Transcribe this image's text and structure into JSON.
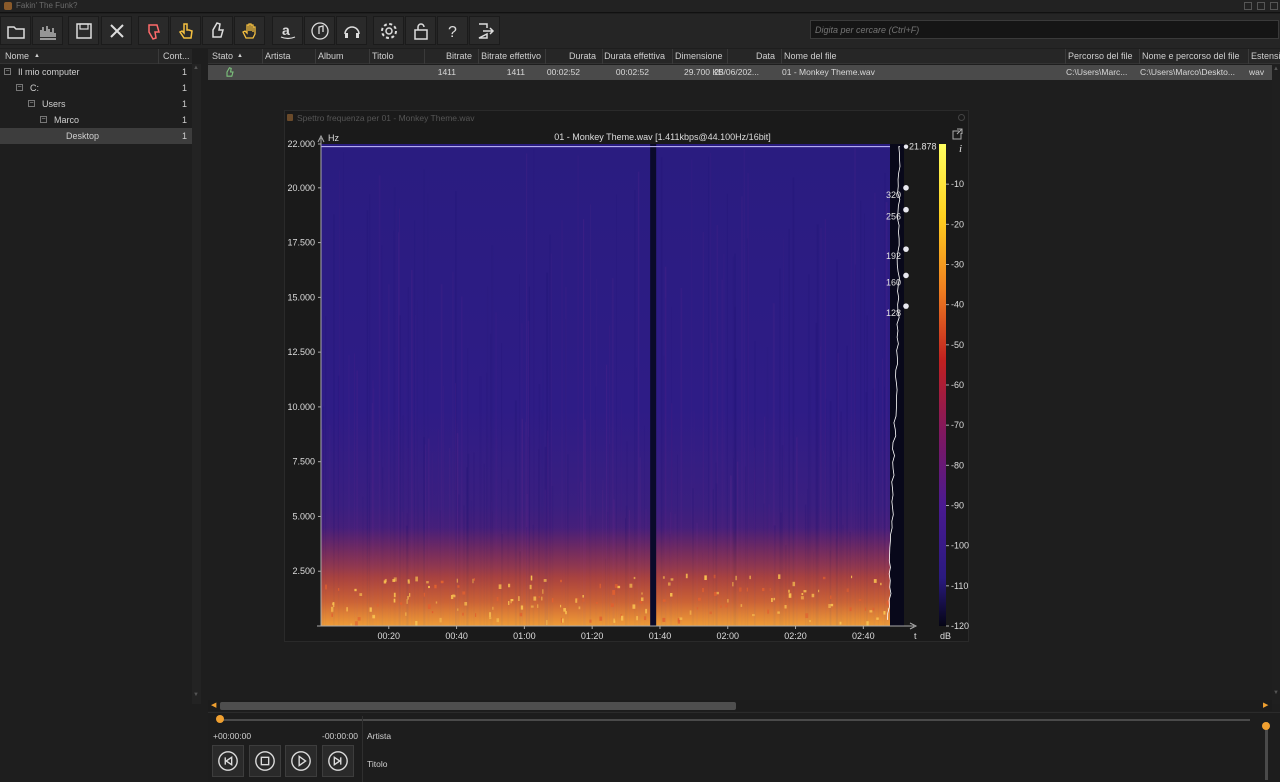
{
  "app": {
    "title": "Fakin' The Funk?"
  },
  "search": {
    "placeholder": "Digita per cercare (Ctrl+F)"
  },
  "toolbar": {
    "buttons": [
      {
        "icon": "folder-open-icon"
      },
      {
        "icon": "spectrum-analysis-icon"
      },
      {
        "icon": "save-icon"
      },
      {
        "icon": "close-x-icon"
      },
      {
        "icon": "thumbs-down-icon"
      },
      {
        "icon": "hand-point-icon"
      },
      {
        "icon": "thumbs-up-icon"
      },
      {
        "icon": "hand-stop-icon"
      },
      {
        "icon": "amazon-icon"
      },
      {
        "icon": "music-note-icon"
      },
      {
        "icon": "headphones-icon"
      },
      {
        "icon": "gear-icon"
      },
      {
        "icon": "unlock-icon"
      },
      {
        "icon": "help-icon"
      },
      {
        "icon": "exit-icon"
      }
    ]
  },
  "tree": {
    "header": {
      "name": "Nome",
      "count": "Cont..."
    },
    "items": [
      {
        "label": "Il mio computer",
        "count": "1",
        "depth": 0,
        "expand": "−"
      },
      {
        "label": "C:",
        "count": "1",
        "depth": 1,
        "expand": "−"
      },
      {
        "label": "Users",
        "count": "1",
        "depth": 2,
        "expand": "−"
      },
      {
        "label": "Marco",
        "count": "1",
        "depth": 3,
        "expand": "−"
      },
      {
        "label": "Desktop",
        "count": "1",
        "depth": 4,
        "expand": "",
        "selected": true
      }
    ]
  },
  "list": {
    "columns": [
      "Stato",
      "Artista",
      "Album",
      "Titolo",
      "Bitrate",
      "Bitrate effettivo",
      "Durata",
      "Durata effettiva",
      "Dimensione",
      "Data",
      "Nome del file",
      "Percorso del file",
      "Nome e percorso del file",
      "Estensione"
    ],
    "rows": [
      {
        "status_icon": "thumbs-up-icon",
        "artista": "",
        "album": "",
        "titolo": "",
        "bitrate": "1411",
        "bitrate_effettivo": "1411",
        "durata": "00:02:52",
        "durata_effettiva": "00:02:52",
        "dimensione": "29.700 KB",
        "data": "25/06/202...",
        "nome_file": "01 - Monkey Theme.wav",
        "percorso": "C:\\Users\\Marc...",
        "nome_percorso": "C:\\Users\\Marco\\Deskto...",
        "estensione": "wav"
      }
    ]
  },
  "player": {
    "time_elapsed": "+00:00:00",
    "time_remaining": "-00:00:00",
    "artist_label": "Artista",
    "title_label": "Titolo",
    "progress": 0.0,
    "volume": 1.0
  },
  "spectrum": {
    "window_title": "Spettro frequenza per 01 - Monkey Theme.wav",
    "plot_title": "01 - Monkey Theme.wav [1.411kbps@44.100Hz/16bit]",
    "y_unit": "Hz",
    "x_unit": "t",
    "cutoff_label": "21.878",
    "info_label": "i",
    "colorbar_unit": "dB",
    "bitrate_markers": [
      {
        "label": "320",
        "hz": 20000
      },
      {
        "label": "256",
        "hz": 19000
      },
      {
        "label": "192",
        "hz": 17200
      },
      {
        "label": "160",
        "hz": 16000
      },
      {
        "label": "128",
        "hz": 14600
      }
    ]
  },
  "chart_data": {
    "type": "heatmap",
    "title": "01 - Monkey Theme.wav [1.411kbps@44.100Hz/16bit]",
    "xlabel": "t",
    "ylabel": "Hz",
    "x_ticks": [
      "00:20",
      "00:40",
      "01:00",
      "01:20",
      "01:40",
      "02:00",
      "02:20",
      "02:40"
    ],
    "x_tick_seconds": [
      20,
      40,
      60,
      80,
      100,
      120,
      140,
      160
    ],
    "xlim": [
      0,
      172
    ],
    "y_ticks": [
      "2.500",
      "5.000",
      "7.500",
      "10.000",
      "12.500",
      "15.000",
      "17.500",
      "20.000",
      "22.000"
    ],
    "y_tick_values": [
      2500,
      5000,
      7500,
      10000,
      12500,
      15000,
      17500,
      20000,
      22000
    ],
    "ylim": [
      0,
      22000
    ],
    "colorbar_ticks": [
      "-10",
      "-20",
      "-30",
      "-40",
      "-50",
      "-60",
      "-70",
      "-80",
      "-90",
      "-100",
      "-110",
      "-120"
    ],
    "colorbar_values": [
      -10,
      -20,
      -30,
      -40,
      -50,
      -60,
      -70,
      -80,
      -90,
      -100,
      -110,
      -120
    ],
    "colorbar_range": [
      -120,
      0
    ],
    "colorbar_unit": "dB",
    "silence_gap_seconds": 98,
    "cutoff_hz": 21878,
    "colors": {
      "background": "#2b1a8a",
      "low_freq": "#f0a030",
      "silence": "#0a0a2a",
      "line": "#ffffff"
    }
  }
}
